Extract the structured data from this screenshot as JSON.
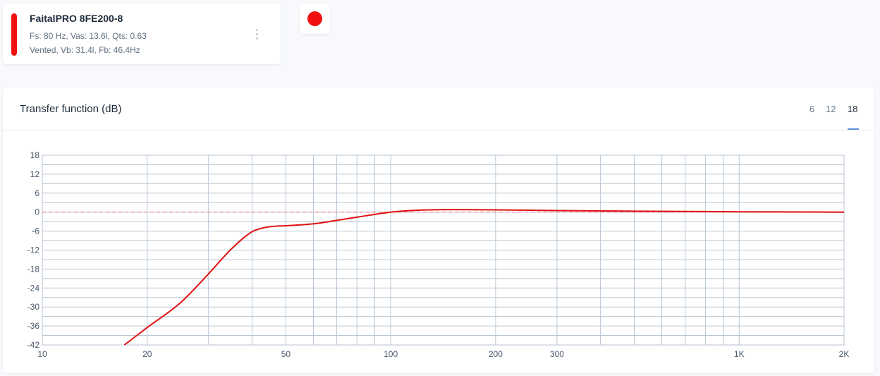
{
  "speaker": {
    "name": "FaitalPRO 8FE200-8",
    "params": "Fs: 80 Hz, Vas: 13.6l, Qts: 0.63",
    "enclosure": "Vented, Vb: 31.4l, Fb: 46.4Hz",
    "color": "#f01010",
    "menu_icon": "kebab-menu-icon"
  },
  "chart_panel": {
    "title": "Transfer function (dB)",
    "tabs": [
      "6",
      "12",
      "18"
    ],
    "active_tab": "18"
  },
  "chart_data": {
    "type": "line",
    "title": "Transfer function (dB)",
    "xscale": "log",
    "xlim": [
      10,
      2000
    ],
    "ylim": [
      -42,
      18
    ],
    "yticks": [
      18,
      12,
      6,
      0,
      -6,
      -12,
      -18,
      -24,
      -30,
      -36,
      -42
    ],
    "yticklabels": [
      "18",
      "12",
      "6",
      "0",
      "-6",
      "-12",
      "-18",
      "-24",
      "-30",
      "-36",
      "-42"
    ],
    "xticks": [
      10,
      20,
      50,
      100,
      200,
      300,
      1000,
      2000
    ],
    "xticklabels": [
      "10",
      "20",
      "50",
      "100",
      "200",
      "300",
      "1K",
      "2K"
    ],
    "grid": true,
    "reference_line": {
      "y": 0,
      "style": "dashed",
      "color": "#f27a8a"
    },
    "series": [
      {
        "color": "#e01010",
        "x": [
          17.2,
          20,
          25,
          30,
          35,
          40,
          43,
          46,
          50,
          60,
          70,
          80,
          90,
          100,
          120,
          150,
          200,
          300,
          500,
          1000,
          2000
        ],
        "y": [
          -42,
          -36.5,
          -28.5,
          -19.5,
          -11.5,
          -6.2,
          -5.0,
          -4.5,
          -4.3,
          -3.7,
          -2.6,
          -1.6,
          -0.7,
          0.0,
          0.6,
          0.8,
          0.7,
          0.5,
          0.3,
          0.1,
          0.0
        ]
      }
    ]
  }
}
